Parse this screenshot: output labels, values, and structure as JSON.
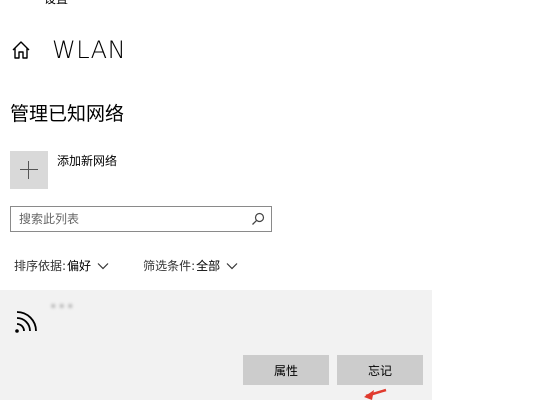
{
  "window": {
    "back_glyph": "←",
    "title": "设置"
  },
  "header": {
    "title": "WLAN"
  },
  "section": {
    "title": "管理已知网络"
  },
  "add_network": {
    "label": "添加新网络"
  },
  "search": {
    "placeholder": "搜索此列表",
    "value": ""
  },
  "filters": {
    "sort_label": "排序依据:",
    "sort_value": "偏好",
    "filter_label": "筛选条件:",
    "filter_value": "全部"
  },
  "network": {
    "name": "•••",
    "buttons": {
      "properties": "属性",
      "forget": "忘记"
    }
  },
  "colors": {
    "card_bg": "#f2f2f2",
    "button_bg": "#cccccc",
    "tile_bg": "#d9d9d9",
    "annotation_arrow": "#e03a2e"
  },
  "icons": {
    "back": "arrow-left-icon",
    "home": "home-icon",
    "add": "plus-icon",
    "search": "search-icon",
    "chevron": "chevron-down-icon",
    "wifi": "wifi-icon"
  }
}
